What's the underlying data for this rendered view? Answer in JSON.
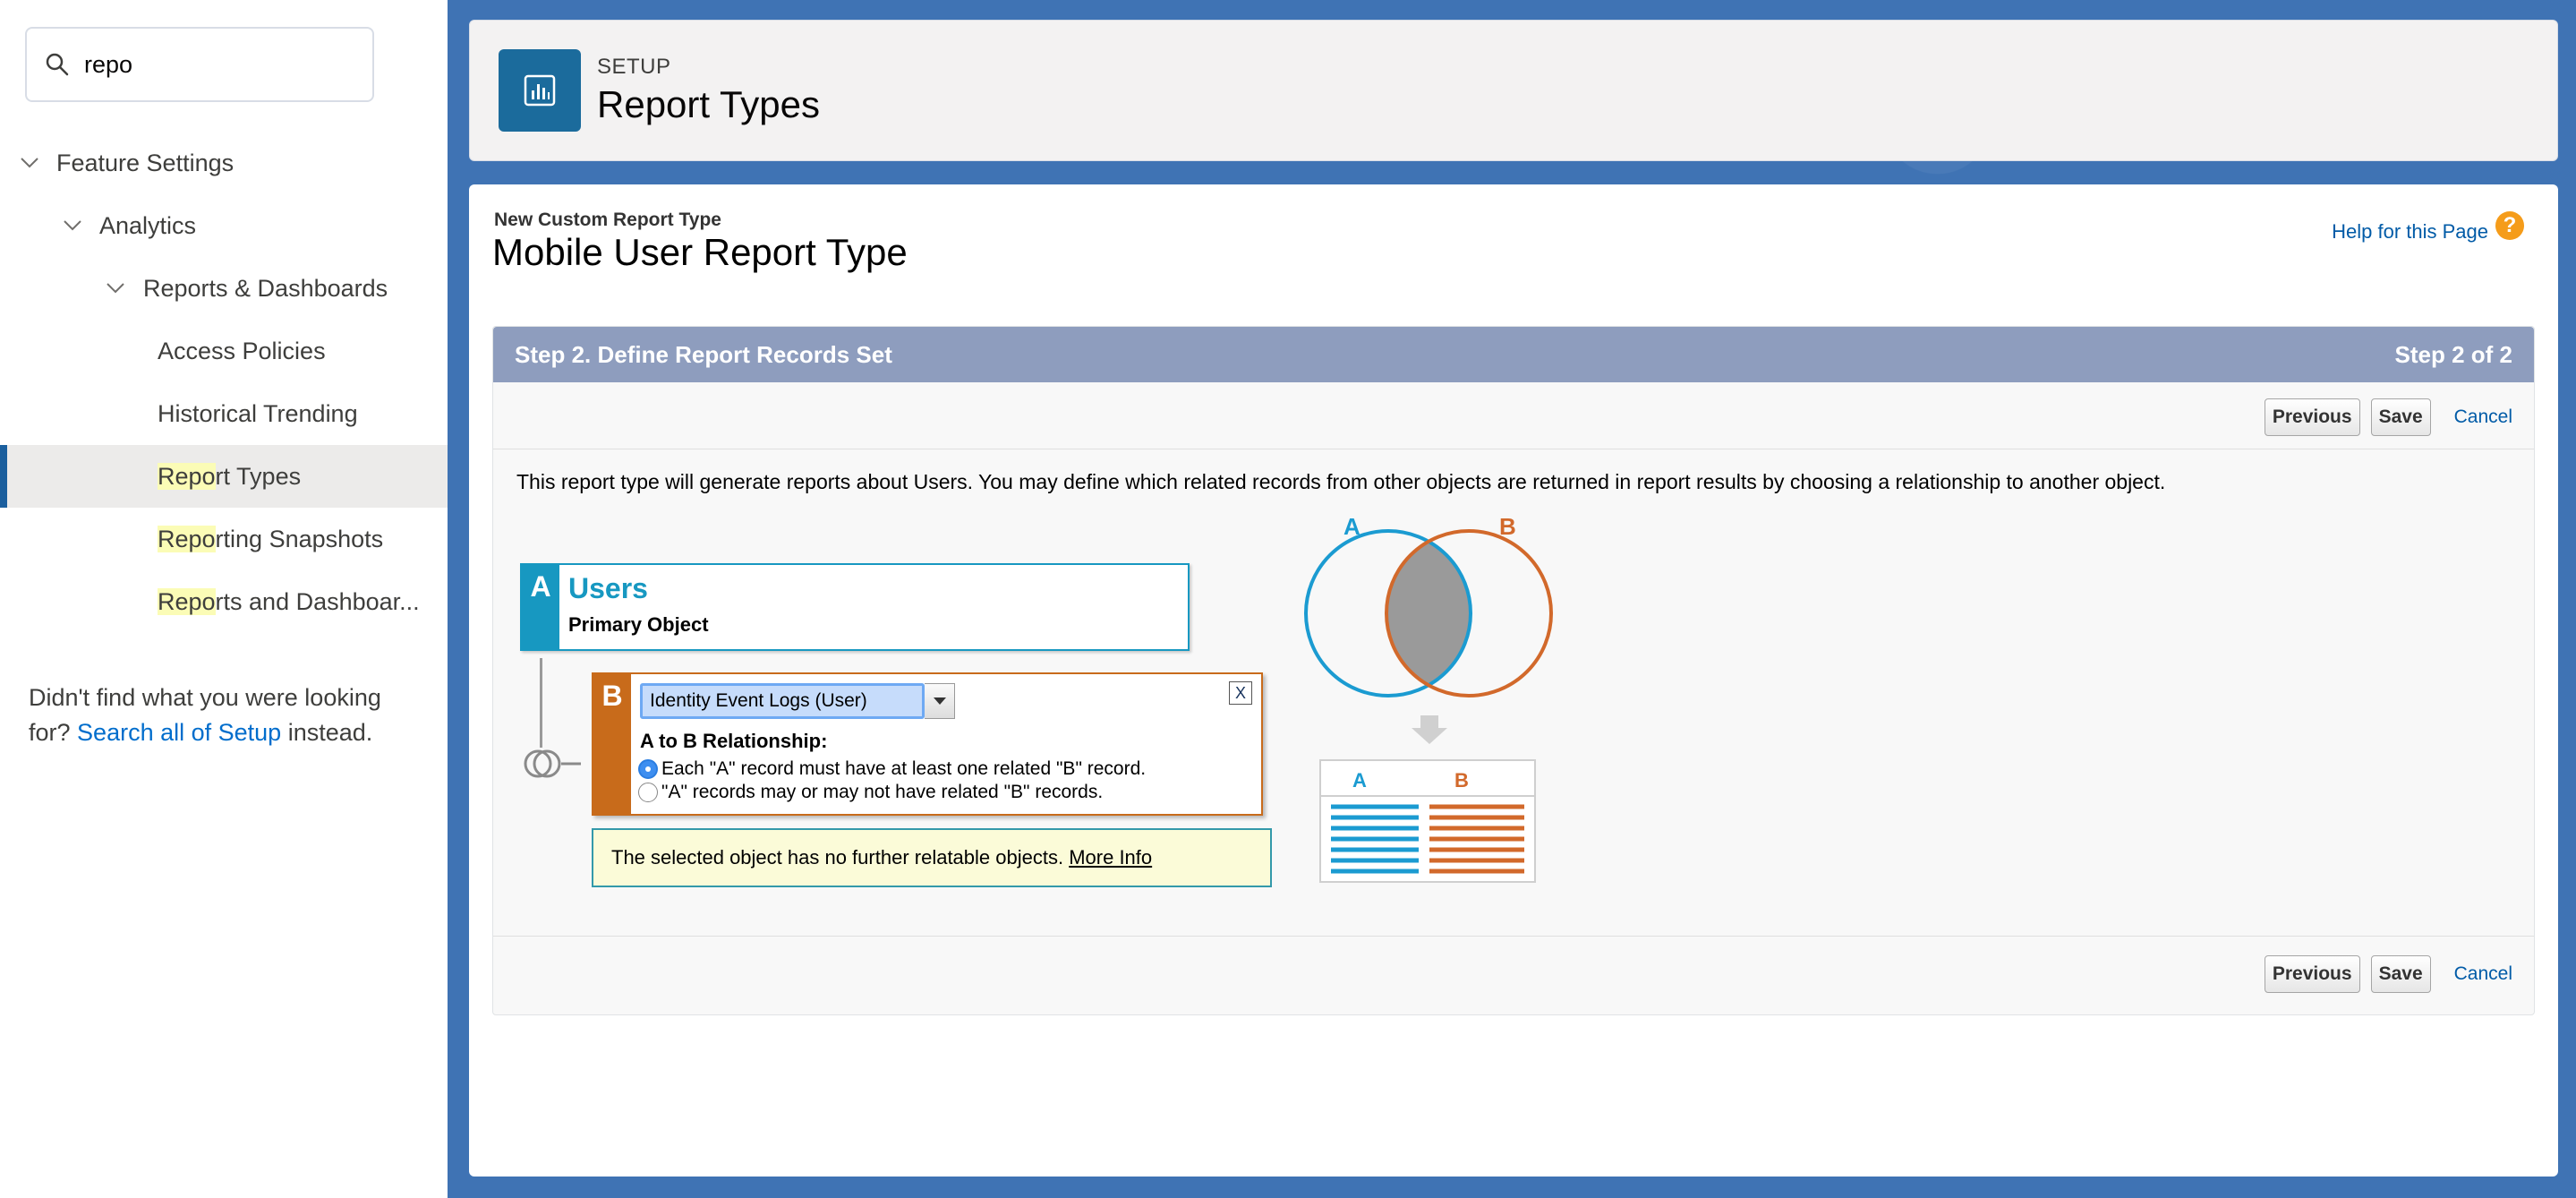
{
  "sidebar": {
    "search": {
      "value": "repo",
      "placeholder": ""
    },
    "tree": [
      {
        "label": "Feature Settings"
      },
      {
        "label": "Analytics"
      },
      {
        "label": "Reports & Dashboards"
      }
    ],
    "items": [
      {
        "label": "Access Policies"
      },
      {
        "label": "Historical Trending"
      },
      {
        "highlight": "Repo",
        "rest": "rt Types",
        "selected": true
      },
      {
        "highlight": "Repo",
        "rest": "rting Snapshots"
      },
      {
        "highlight": "Repo",
        "rest": "rts and Dashboar..."
      }
    ],
    "not_found": {
      "prefix": "Didn't find what you were looking for?",
      "link": "Search all of Setup",
      "suffix": "instead."
    }
  },
  "header": {
    "eyebrow": "SETUP",
    "title": "Report Types",
    "icon": "report-chart-icon"
  },
  "page": {
    "eyebrow": "New Custom Report Type",
    "title": "Mobile User Report Type",
    "help_link": "Help for this Page",
    "help_icon": "?"
  },
  "step": {
    "title": "Step 2. Define Report Records Set",
    "counter": "Step 2 of 2",
    "buttons": {
      "previous": "Previous",
      "save": "Save",
      "cancel": "Cancel"
    },
    "intro": "This report type will generate reports about Users. You may define which related records from other objects are returned in report results by choosing a relationship to another object."
  },
  "object_a": {
    "tag": "A",
    "name": "Users",
    "subtitle": "Primary Object"
  },
  "object_b": {
    "tag": "B",
    "selected_value": "Identity Event Logs (User)",
    "close": "X",
    "relationship_label": "A to B Relationship:",
    "options": [
      {
        "label": "Each \"A\" record must have at least one related \"B\" record.",
        "checked": true
      },
      {
        "label": "\"A\" records may or may not have related \"B\" records.",
        "checked": false
      }
    ]
  },
  "info": {
    "text": "The selected object has no further relatable objects.",
    "link": "More Info"
  },
  "venn": {
    "label_a": "A",
    "label_b": "B",
    "table_a": "A",
    "table_b": "B",
    "color_a": "#1b9bd1",
    "color_b": "#d2692b"
  }
}
